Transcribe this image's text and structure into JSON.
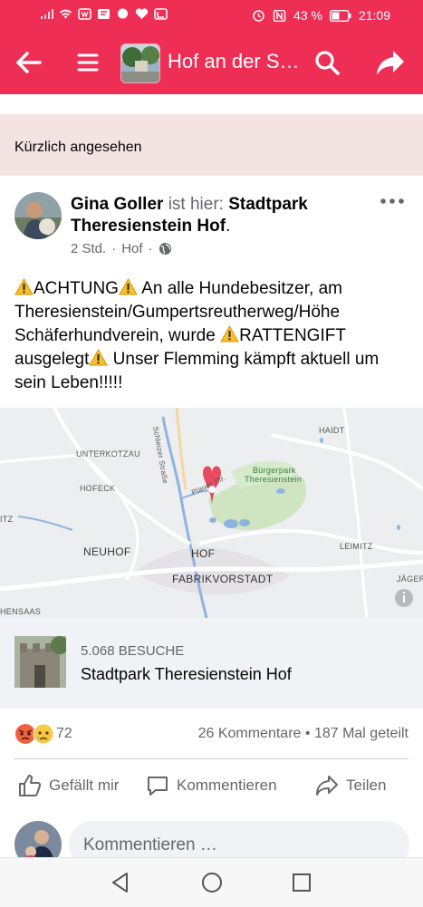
{
  "status_bar": {
    "battery": "43 %",
    "time": "21:09"
  },
  "app_bar": {
    "title": "Hof an der S…",
    "icons": [
      "back-arrow-icon",
      "menu-icon",
      "search-icon",
      "share-icon"
    ]
  },
  "recent_section": {
    "label": "Kürzlich angesehen"
  },
  "post": {
    "author": "Gina Goller",
    "is_here": "ist hier:",
    "place_link": "Stadtpark Theresienstein Hof",
    "period": ".",
    "time": "2 Std.",
    "location": "Hof",
    "separator": "·",
    "text_parts": [
      "ACHTUNG",
      " An alle Hundebesitzer, am Theresienstein/Gumpertsreutherweg/Höhe Schäferhundverein, wurde ",
      "RATTENGIFT ausgelegt",
      " Unser Flemming kämpft aktuell um sein Leben!!!!!"
    ]
  },
  "map": {
    "labels": {
      "unterkotzau": "UNTERKOTZAU",
      "hofeck": "HOFECK",
      "neuhof": "NEUHOF",
      "hof": "HOF",
      "fabrikvorstadt": "FABRIKVORSTADT",
      "haidt": "HAIDT",
      "leimitz": "LEIMITZ",
      "jaeger": "JÄGER",
      "buergerpark1": "Bürgerpark",
      "buergerpark2": "Theresienstein",
      "schleizer": "Schleizer Straße",
      "plauer": "Plauer Str.",
      "itz": "ITZ",
      "hensaas": "HENSAAS"
    }
  },
  "place_card": {
    "visits": "5.068 BESUCHE",
    "name": "Stadtpark Theresienstein Hof"
  },
  "stats": {
    "reaction_count": "72",
    "comments": "26 Kommentare",
    "dot": "•",
    "shares": "187 Mal geteilt"
  },
  "actions": {
    "like": "Gefällt mir",
    "comment": "Kommentieren",
    "share": "Teilen"
  },
  "composer": {
    "placeholder": "Kommentieren …"
  },
  "colors": {
    "brand": "#ef2e55",
    "text": "#050505",
    "secondary": "#65676b"
  }
}
